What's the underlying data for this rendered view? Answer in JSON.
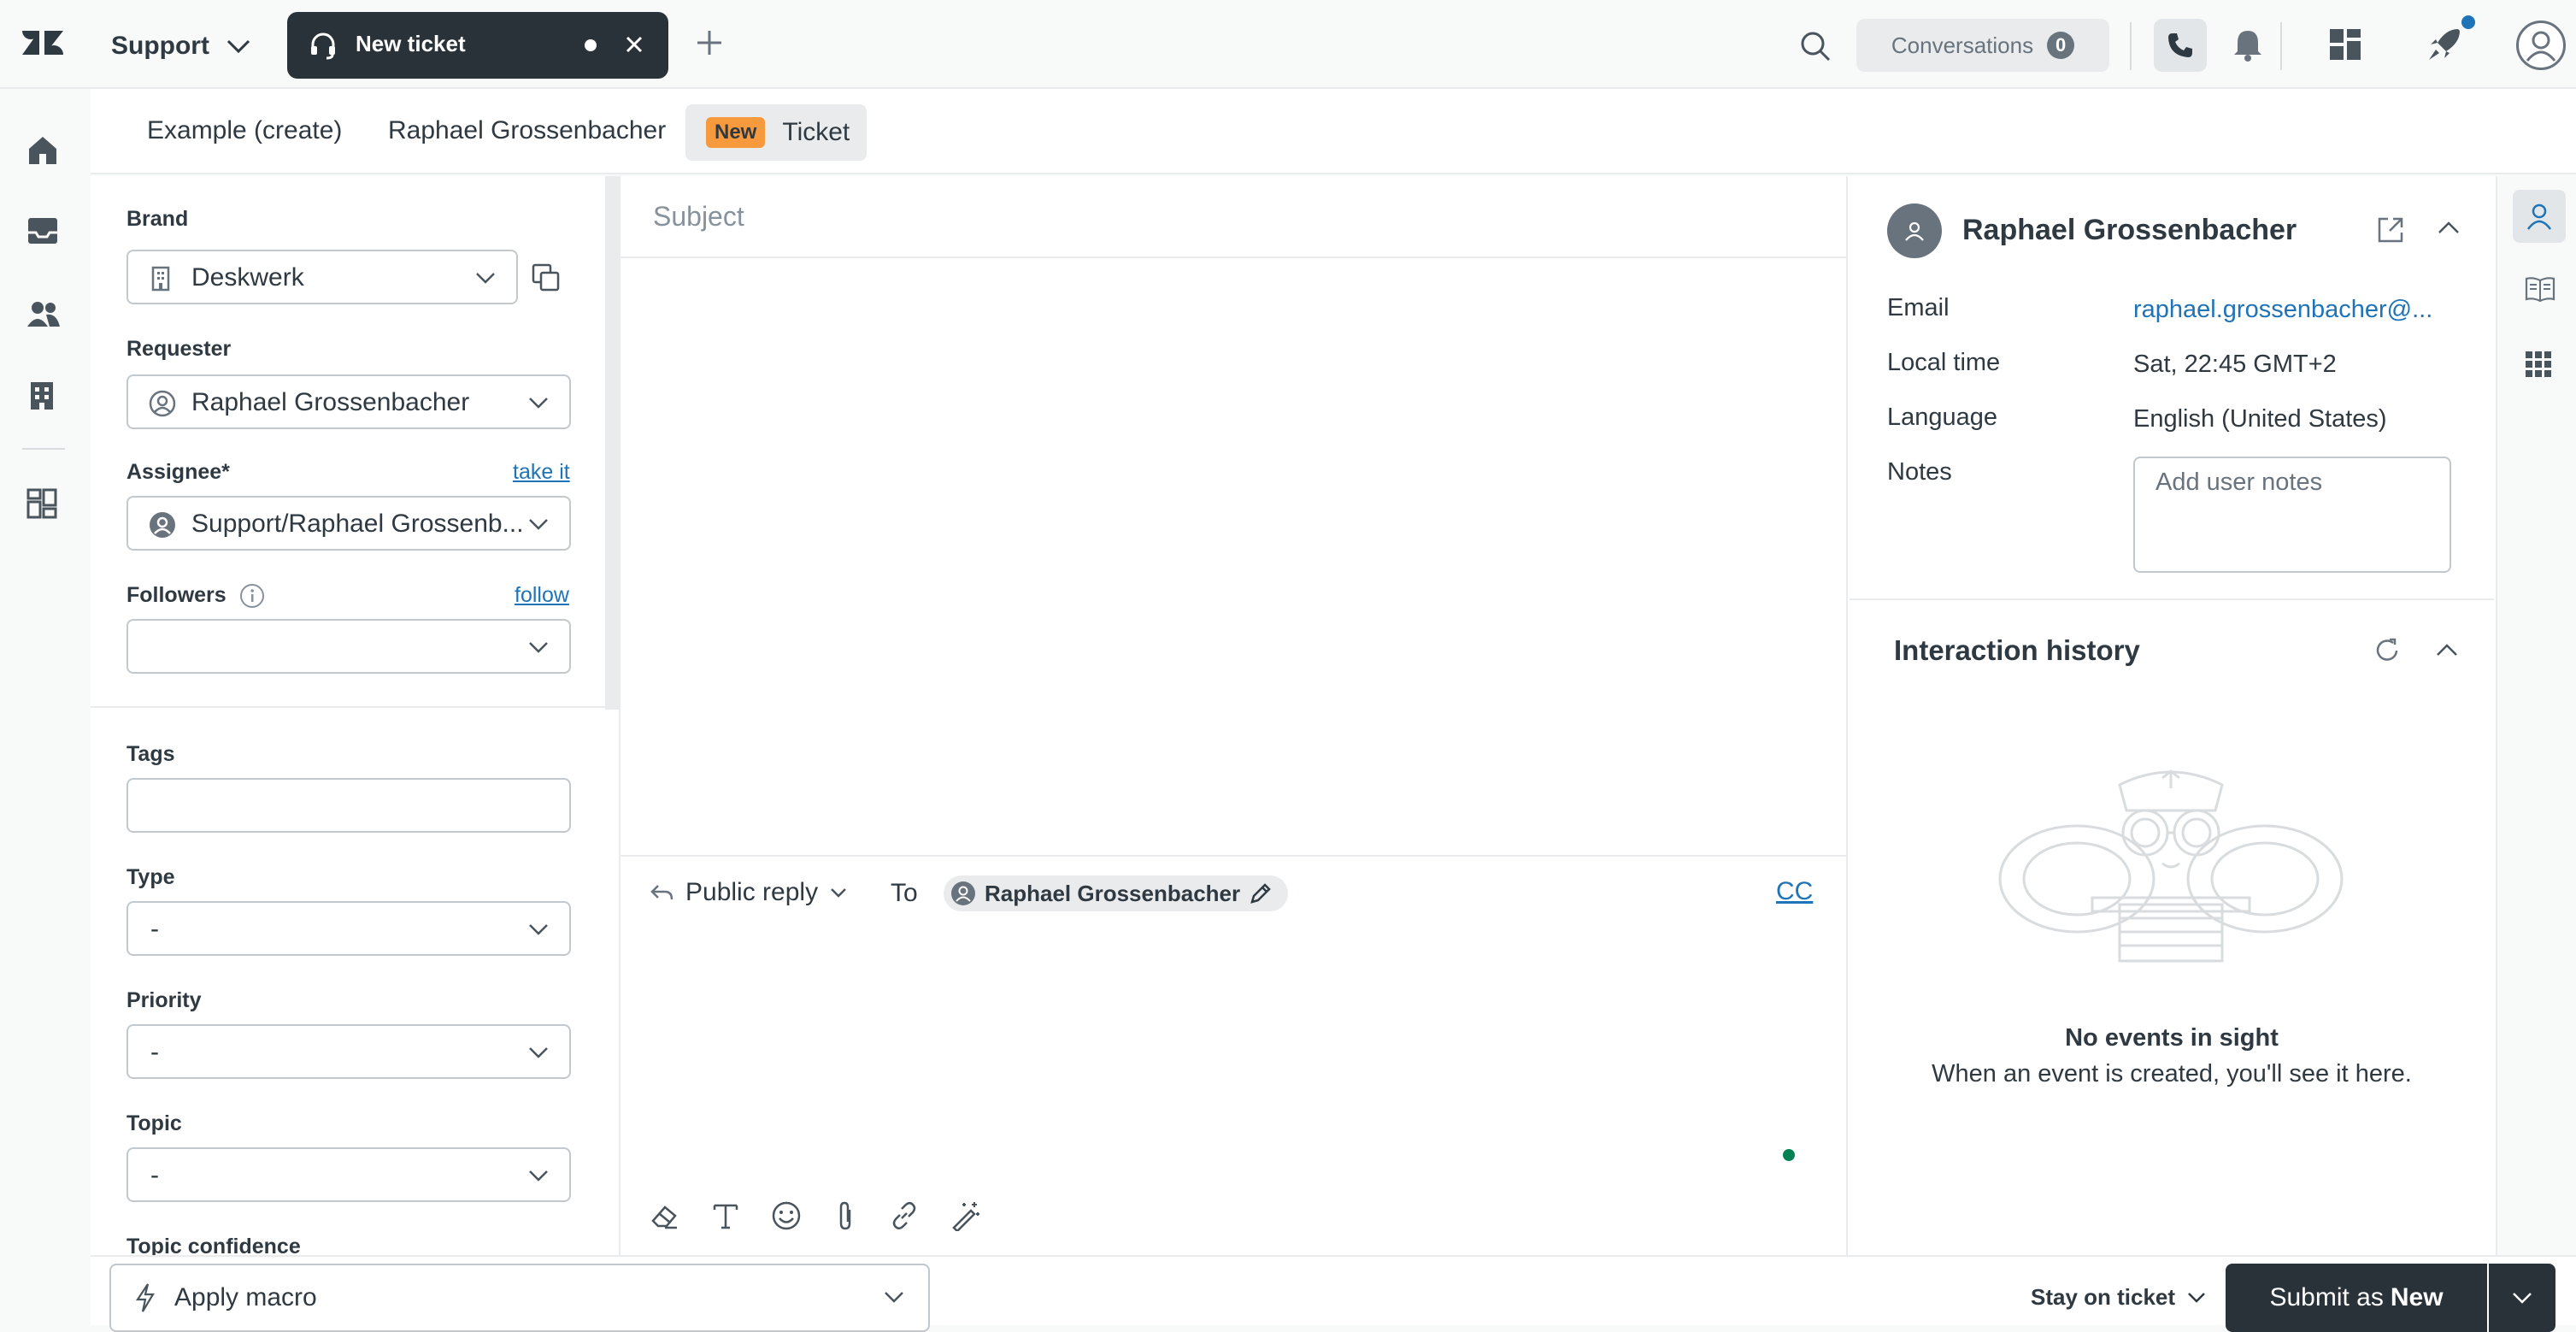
{
  "topbar": {
    "product": "Support",
    "active_tab": "New ticket",
    "conversations_label": "Conversations",
    "conversations_count": "0"
  },
  "subtabs": {
    "example": "Example (create)",
    "user": "Raphael Grossenbacher",
    "badge": "New",
    "ticket": "Ticket"
  },
  "form": {
    "brand_label": "Brand",
    "brand_value": "Deskwerk",
    "requester_label": "Requester",
    "requester_value": "Raphael Grossenbacher",
    "assignee_label": "Assignee*",
    "assignee_link": "take it",
    "assignee_value": "Support/Raphael Grossenb...",
    "followers_label": "Followers",
    "followers_link": "follow",
    "followers_value": "",
    "tags_label": "Tags",
    "tags_value": "",
    "type_label": "Type",
    "type_value": "-",
    "priority_label": "Priority",
    "priority_value": "-",
    "topic_label": "Topic",
    "topic_value": "-",
    "topic_confidence_label": "Topic confidence"
  },
  "editor": {
    "subject_placeholder": "Subject",
    "reply_type": "Public reply",
    "to_label": "To",
    "recipient": "Raphael Grossenbacher",
    "cc_label": "CC"
  },
  "context": {
    "user_name": "Raphael Grossenbacher",
    "email_label": "Email",
    "email_value": "raphael.grossenbacher@...",
    "local_time_label": "Local time",
    "local_time_value": "Sat, 22:45 GMT+2",
    "language_label": "Language",
    "language_value": "English (United States)",
    "notes_label": "Notes",
    "notes_placeholder": "Add user notes",
    "interaction_history_title": "Interaction history",
    "empty_title": "No events in sight",
    "empty_subtitle": "When an event is created, you'll see it here."
  },
  "bottom": {
    "macro_label": "Apply macro",
    "stay_label": "Stay on ticket",
    "submit_prefix": "Submit as",
    "submit_status": "New"
  },
  "colors": {
    "dark": "#293239",
    "link": "#1f73b7",
    "badge_new": "#f79a3e",
    "status_online": "#038153"
  }
}
